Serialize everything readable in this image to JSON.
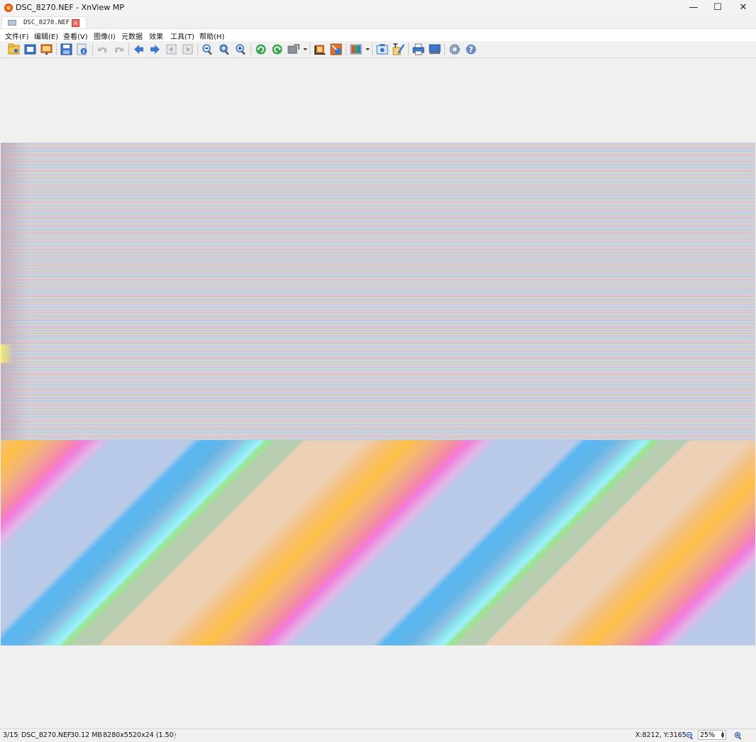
{
  "window": {
    "title": "DSC_8270.NEF - XnView MP",
    "min_glyph": "—",
    "max_glyph": "☐",
    "close_glyph": "✕",
    "icon": "xnview-logo-icon"
  },
  "tab": {
    "label": "DSC_8270.NEF",
    "close_glyph": "×",
    "icon": "image-file-icon"
  },
  "menu": {
    "items": [
      "文件(F)",
      "编辑(E)",
      "查看(V)",
      "图像(I)",
      "元数据",
      "效果",
      "工具(T)",
      "帮助(H)"
    ]
  },
  "toolbar": {
    "icons": [
      "browser-icon",
      "fullscreen-icon",
      "slideshow-icon",
      "save-icon",
      "properties-icon",
      "undo-icon",
      "redo-icon",
      "previous-icon",
      "next-icon",
      "first-page-icon",
      "last-page-icon",
      "zoom-out-icon",
      "zoom-fit-icon",
      "zoom-in-icon",
      "rotate-left-icon",
      "rotate-right-icon",
      "transform-icon",
      "crop-icon",
      "resize-icon",
      "adjust-colors-icon",
      "capture-icon",
      "edit-text-icon",
      "print-icon",
      "scanner-icon",
      "settings-icon",
      "help-icon"
    ]
  },
  "colors": {
    "window_bg": "#f0f0f0",
    "accent_close": "#f06d5d",
    "icon_blue": "#3c77c9",
    "icon_green": "#3aa64b"
  },
  "status": {
    "index": "3/15",
    "filename": "DSC_8270.NEF",
    "filesize": "30.12 MB",
    "dimensions": "8280x5520x24 (1.50)",
    "coords": "X:8212, Y:3165",
    "zoom": "25%"
  }
}
